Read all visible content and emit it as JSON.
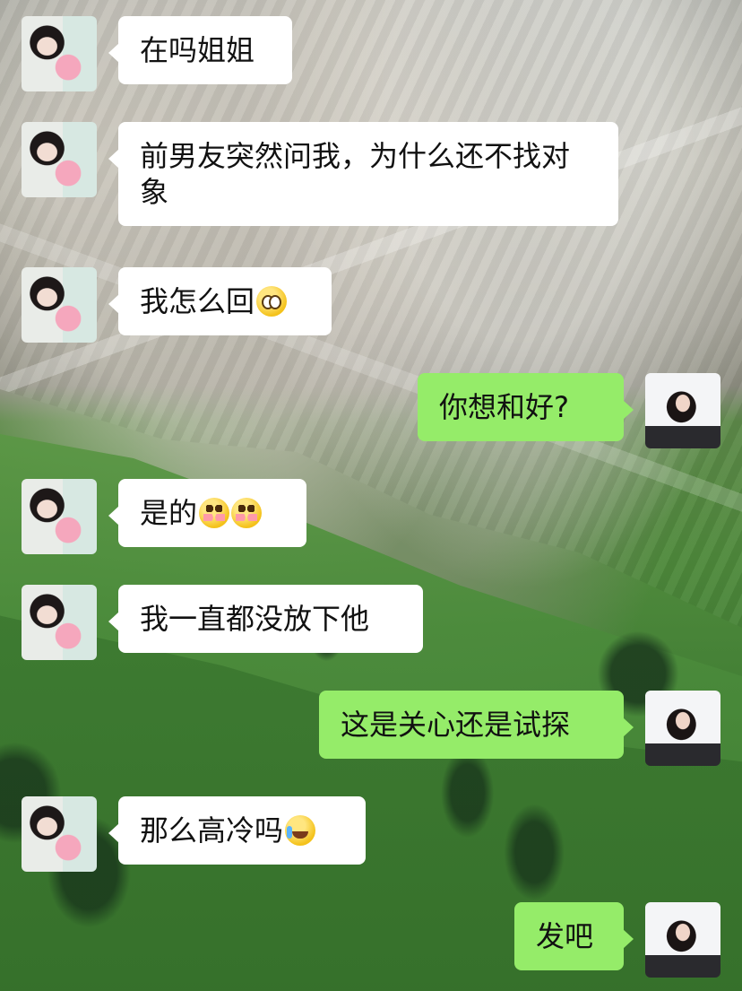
{
  "messages": [
    {
      "side": "left",
      "text": "在吗姐姐",
      "emojis": []
    },
    {
      "side": "left",
      "text": "前男友突然问我，为什么还不找对象",
      "emojis": []
    },
    {
      "side": "left",
      "text": "我怎么回",
      "emojis": [
        "pleading-face-emoji"
      ]
    },
    {
      "side": "right",
      "text": "你想和好?",
      "emojis": []
    },
    {
      "side": "left",
      "text": "是的",
      "emojis": [
        "flushed-face-emoji",
        "flushed-face-emoji"
      ]
    },
    {
      "side": "left",
      "text": "我一直都没放下他",
      "emojis": []
    },
    {
      "side": "right",
      "text": "这是关心还是试探",
      "emojis": []
    },
    {
      "side": "left",
      "text": "那么高冷吗",
      "emojis": [
        "crying-face-emoji"
      ]
    },
    {
      "side": "right",
      "text": "发吧",
      "emojis": []
    }
  ],
  "colors": {
    "incoming_bubble": "#ffffff",
    "outgoing_bubble": "#95ec69",
    "text": "#111111"
  }
}
